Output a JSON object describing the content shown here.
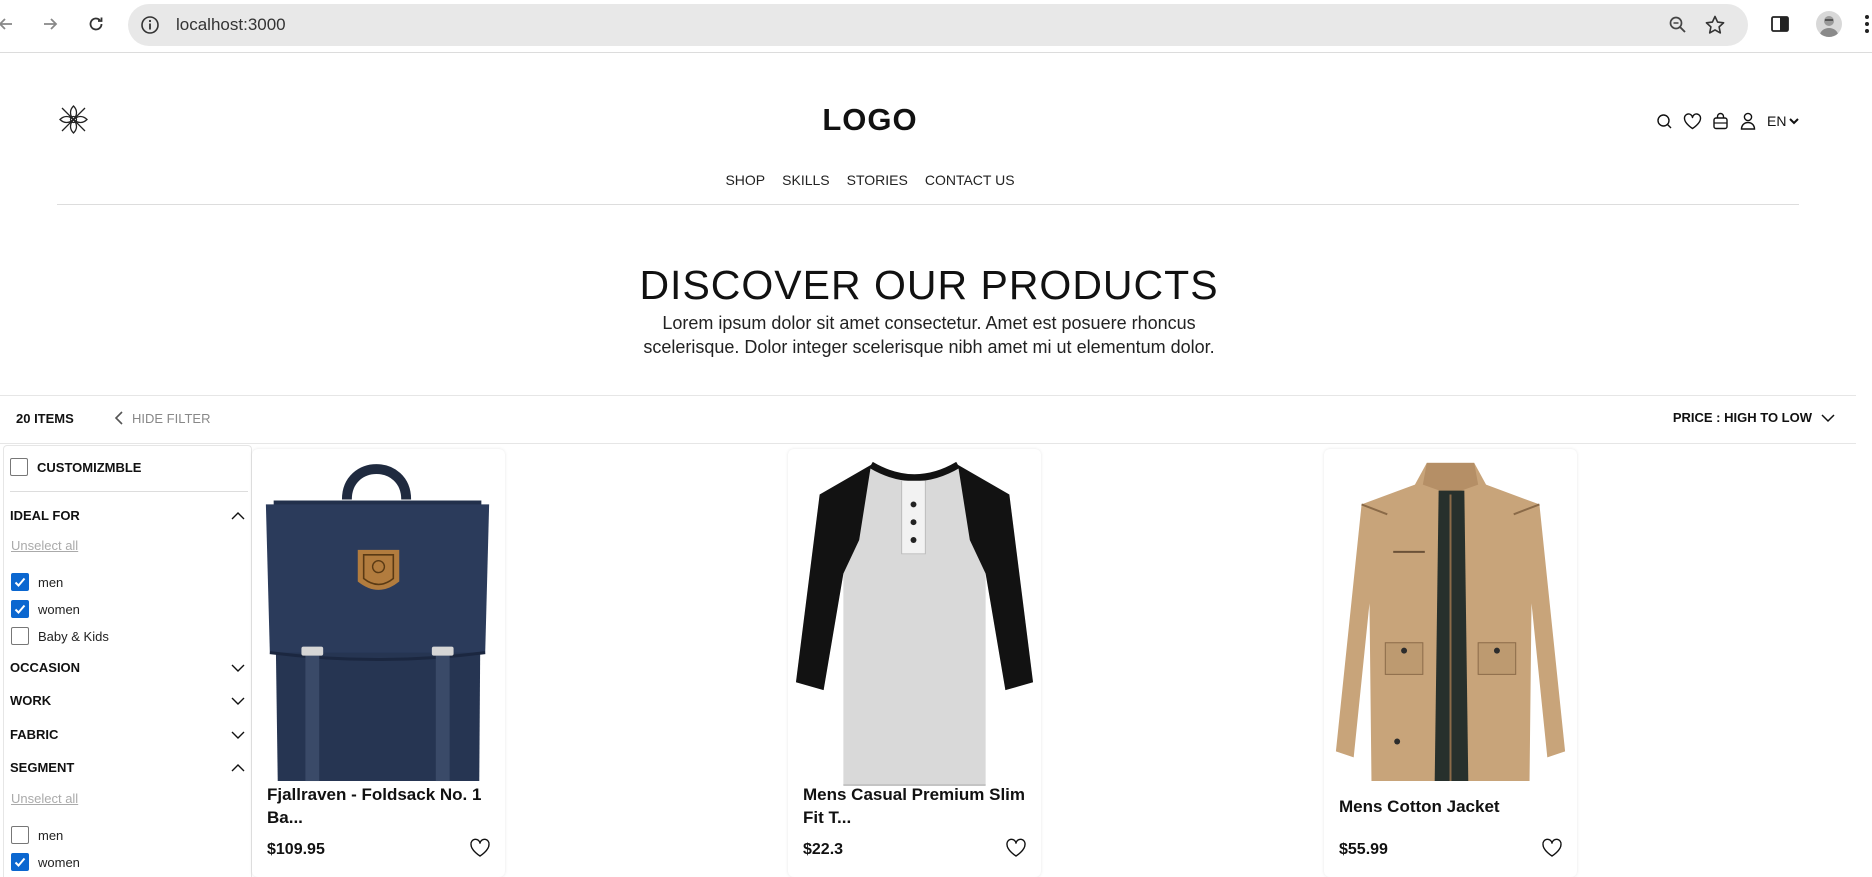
{
  "browser": {
    "url": "localhost:3000",
    "icons": [
      "back-arrow-icon",
      "forward-arrow-icon",
      "reload-icon",
      "info-icon",
      "zoom-icon",
      "star-icon",
      "side-panel-icon",
      "profile-avatar",
      "kebab-menu-icon"
    ]
  },
  "header": {
    "logo_text": "LOGO",
    "language": "EN",
    "nav": [
      "SHOP",
      "SKILLS",
      "STORIES",
      "CONTACT US"
    ]
  },
  "hero": {
    "title": "DISCOVER OUR PRODUCTS",
    "description": "Lorem ipsum dolor sit amet consectetur. Amet est posuere rhoncus scelerisque. Dolor integer scelerisque nibh amet mi ut elementum dolor."
  },
  "toolbar": {
    "items_count": "20 ITEMS",
    "hide_filter": "HIDE FILTER",
    "sort": "PRICE : HIGH TO LOW"
  },
  "filters": {
    "customizable": {
      "label": "CUSTOMIZMBLE",
      "checked": false
    },
    "ideal_for": {
      "title": "IDEAL FOR",
      "expanded": true,
      "unselect": "Unselect all",
      "options": [
        {
          "label": "men",
          "checked": true
        },
        {
          "label": "women",
          "checked": true
        },
        {
          "label": "Baby & Kids",
          "checked": false
        }
      ]
    },
    "occasion": {
      "title": "OCCASION",
      "expanded": false
    },
    "work": {
      "title": "WORK",
      "expanded": false
    },
    "fabric": {
      "title": "FABRIC",
      "expanded": false
    },
    "segment": {
      "title": "SEGMENT",
      "expanded": true,
      "unselect": "Unselect all",
      "options": [
        {
          "label": "men",
          "checked": false
        },
        {
          "label": "women",
          "checked": true
        }
      ]
    }
  },
  "products": [
    {
      "name": "Fjallraven - Foldsack No. 1 Ba...",
      "price": "$109.95",
      "image": "backpack"
    },
    {
      "name": "Mens Casual Premium Slim Fit T...",
      "price": "$22.3",
      "image": "raglan-tshirt"
    },
    {
      "name": "Mens Cotton Jacket",
      "price": "$55.99",
      "image": "khaki-jacket"
    }
  ],
  "colors": {
    "checkbox_checked": "#0b67d0",
    "muted_text": "#888888",
    "divider": "#e6e6e6"
  }
}
